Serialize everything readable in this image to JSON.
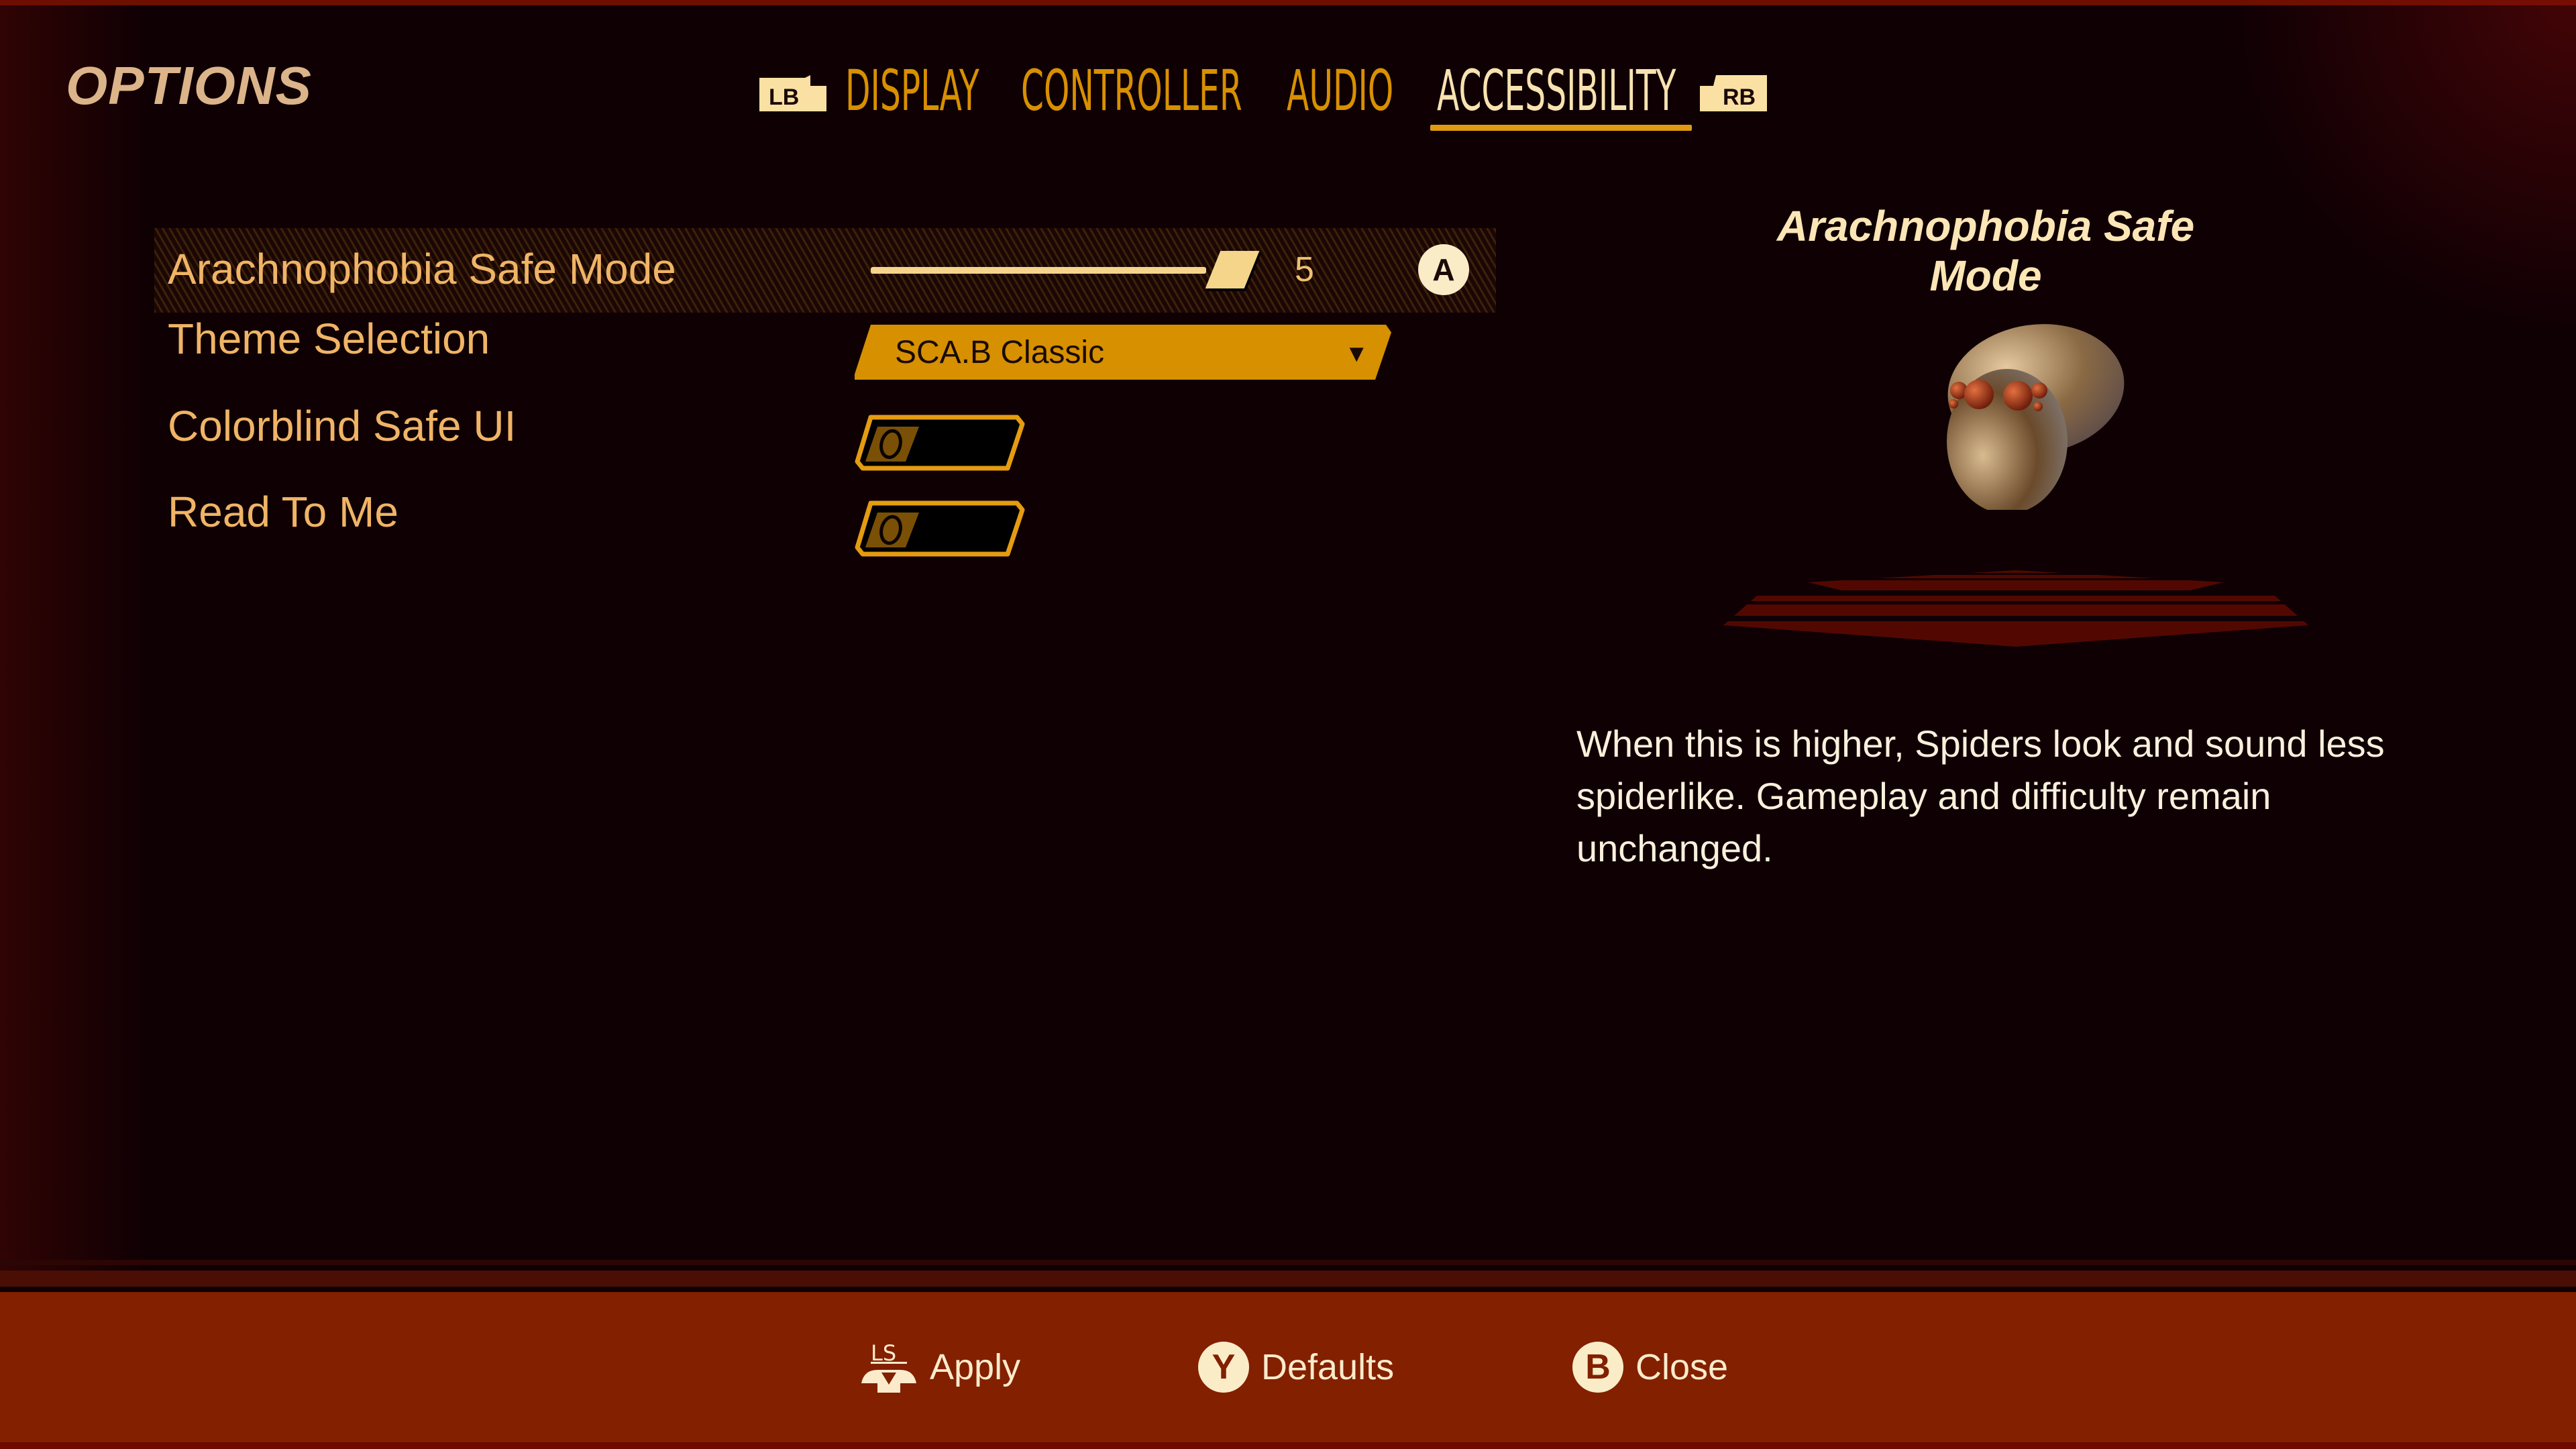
{
  "header": {
    "title": "OPTIONS",
    "left_bumper": "LB",
    "right_bumper": "RB",
    "tabs": [
      {
        "label": "DISPLAY",
        "active": false
      },
      {
        "label": "CONTROLLER",
        "active": false
      },
      {
        "label": "AUDIO",
        "active": false
      },
      {
        "label": "ACCESSIBILITY",
        "active": true
      }
    ]
  },
  "settings": {
    "arachnophobia": {
      "label": "Arachnophobia Safe Mode",
      "value": "5",
      "value_fraction": 1.0,
      "action_button": "A"
    },
    "theme": {
      "label": "Theme Selection",
      "selected": "SCA.B Classic",
      "arrow": "▼"
    },
    "colorblind": {
      "label": "Colorblind Safe UI",
      "state": "off"
    },
    "read_to_me": {
      "label": "Read To Me",
      "state": "off"
    }
  },
  "detail": {
    "title": "Arachnophobia Safe Mode",
    "preview": "spider-preview-safe-mode",
    "description": "When this is higher, Spiders look and sound less spiderlike. Gameplay and difficulty remain unchanged."
  },
  "footer": {
    "apply": {
      "button": "LS",
      "label": "Apply"
    },
    "defaults": {
      "button": "Y",
      "label": "Defaults"
    },
    "close": {
      "button": "B",
      "label": "Close"
    }
  },
  "colors": {
    "accent": "#d69000",
    "active_tab": "#f8e2b0",
    "label": "#f0b466",
    "footer_bg": "#822000",
    "background": "#0f0004"
  }
}
